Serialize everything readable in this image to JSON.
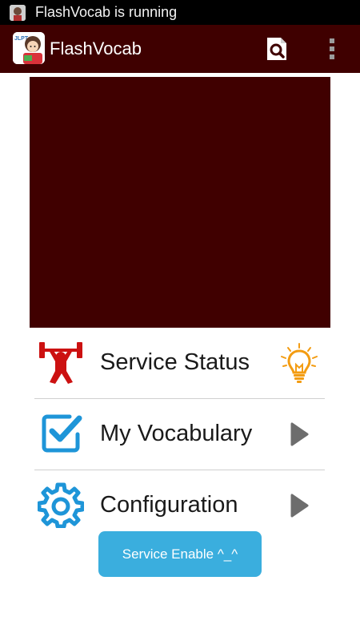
{
  "status_bar": {
    "notification_text": "FlashVocab is running",
    "notification_icon": "app-notification-icon"
  },
  "action_bar": {
    "title": "FlashVocab",
    "logo_text": "JLPT",
    "logo_icon": "girl-avatar-logo",
    "search_icon": "search-document-icon",
    "overflow_icon": "overflow-menu-icon",
    "background_color": "#3f0000"
  },
  "banner": {
    "background_color": "#400000"
  },
  "menu": {
    "items": [
      {
        "label": "Service Status",
        "icon": "weightlifter-icon",
        "end_icon": "lightbulb-icon"
      },
      {
        "label": "My Vocabulary",
        "icon": "checkbox-icon",
        "end_icon": "play-arrow-icon"
      },
      {
        "label": "Configuration",
        "icon": "gear-icon",
        "end_icon": "play-arrow-icon"
      }
    ]
  },
  "service_button": {
    "label": "Service Enable ^_^",
    "color": "#3aaede"
  }
}
